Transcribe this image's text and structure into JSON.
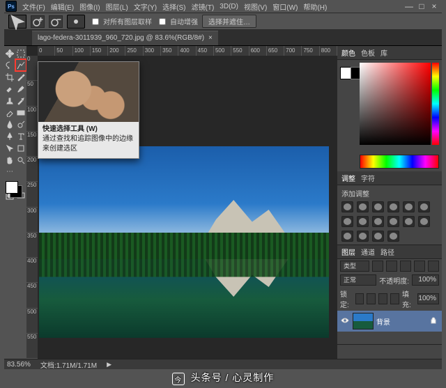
{
  "app": {
    "ps_icon": "Ps"
  },
  "menu": {
    "file": "文件(F)",
    "edit": "编辑(E)",
    "image": "图像(I)",
    "layer": "图层(L)",
    "type": "文字(Y)",
    "select": "选择(S)",
    "filter": "滤镜(T)",
    "threeD": "3D(D)",
    "view": "视图(V)",
    "window": "窗口(W)",
    "help": "帮助(H)"
  },
  "winctl": {
    "min": "—",
    "max": "□",
    "close": "×"
  },
  "options": {
    "sample_all": "对所有图层取样",
    "auto_enhance": "自动增强",
    "select_subject": "选择并遮住…"
  },
  "doc": {
    "tab_label": "lago-federa-3011939_960_720.jpg @ 83.6%(RGB/8#)",
    "close": "×"
  },
  "ruler_h": [
    "0",
    "50",
    "100",
    "150",
    "200",
    "250",
    "300",
    "350",
    "400",
    "450",
    "500",
    "550",
    "600",
    "650",
    "700",
    "750",
    "800"
  ],
  "ruler_v": [
    "0",
    "50",
    "100",
    "150",
    "200",
    "250",
    "300",
    "350",
    "400",
    "450",
    "500",
    "550"
  ],
  "tooltip": {
    "title": "快速选择工具 (W)",
    "body": "通过查找和追踪图像中的边缘来创建选区"
  },
  "panels": {
    "color_tabs": {
      "color": "颜色",
      "swatches": "色板",
      "lib": "库"
    },
    "adjust_tabs": {
      "adjust": "调整",
      "styles": "字符"
    },
    "adjust_title": "添加调整",
    "layers_tabs": {
      "layers": "图层",
      "channels": "通道",
      "paths": "路径"
    },
    "kind": "类型",
    "blend": "正常",
    "opacity_label": "不透明度:",
    "opacity_val": "100%",
    "lock_label": "锁定:",
    "fill_label": "填充:",
    "fill_val": "100%",
    "layer_name": "背景"
  },
  "status": {
    "zoom": "83.56%",
    "docinfo": "文档:1.71M/1.71M"
  },
  "watermark": {
    "logo": "今",
    "text": "头条号 / 心灵制作"
  }
}
